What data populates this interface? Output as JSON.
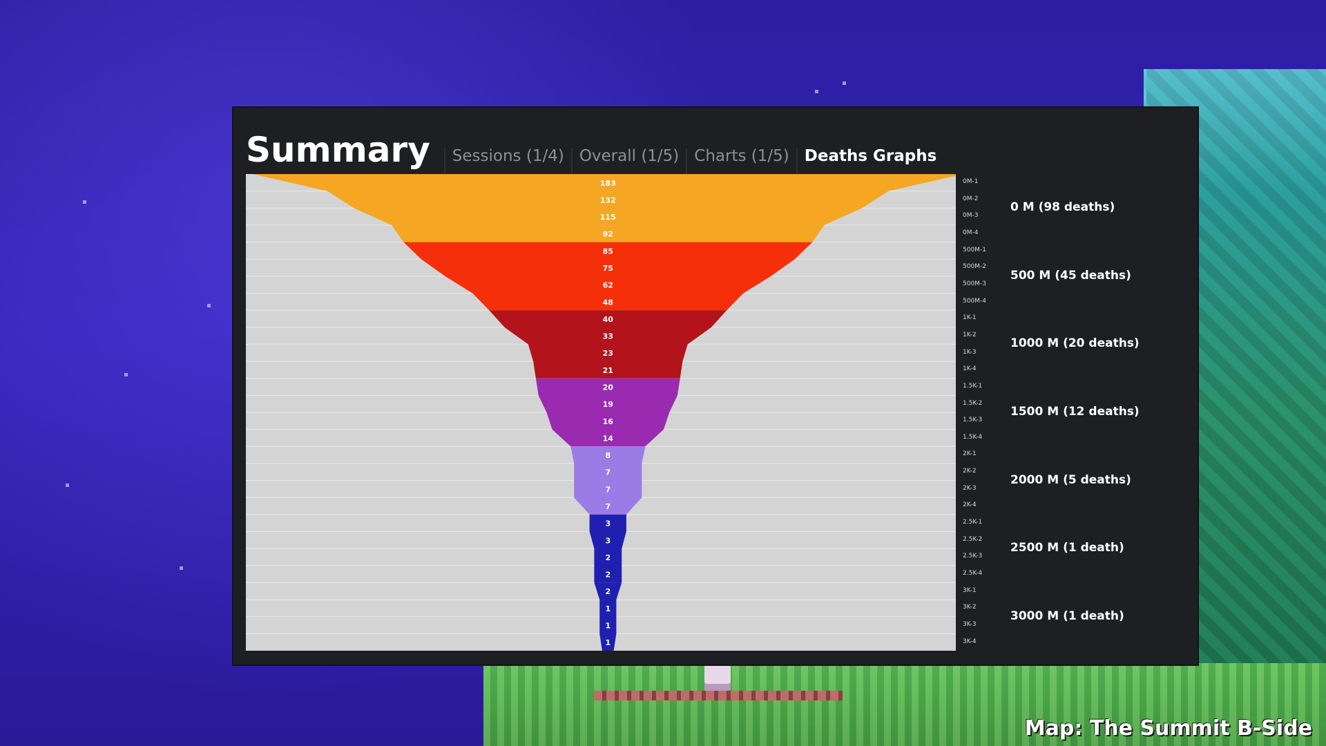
{
  "summary": {
    "title": "Summary",
    "tabs": [
      {
        "label": "Sessions (1/4)",
        "active": false
      },
      {
        "label": "Overall (1/5)",
        "active": false
      },
      {
        "label": "Charts (1/5)",
        "active": false
      },
      {
        "label": "Deaths Graphs",
        "active": true
      }
    ]
  },
  "chart_data": {
    "type": "area",
    "categories": [
      "0M-1",
      "0M-2",
      "0M-3",
      "0M-4",
      "500M-1",
      "500M-2",
      "500M-3",
      "500M-4",
      "1K-1",
      "1K-2",
      "1K-3",
      "1K-4",
      "1.5K-1",
      "1.5K-2",
      "1.5K-3",
      "1.5K-4",
      "2K-1",
      "2K-2",
      "2K-3",
      "2K-4",
      "2.5K-1",
      "2.5K-2",
      "2.5K-3",
      "2.5K-4",
      "3K-1",
      "3K-2",
      "3K-3",
      "3K-4"
    ],
    "values": [
      183,
      132,
      115,
      92,
      85,
      75,
      62,
      48,
      40,
      33,
      23,
      21,
      20,
      19,
      16,
      14,
      8,
      7,
      7,
      7,
      3,
      3,
      2,
      2,
      2,
      1,
      1,
      1
    ],
    "band_colors": [
      "#f5a623",
      "#f52f0a",
      "#b3131a",
      "#9a2bb0",
      "#9b7be6",
      "#1f20b0",
      "#1f20b0"
    ],
    "summaries": [
      {
        "label": "0 M (98 deaths)"
      },
      {
        "label": "500 M (45 deaths)"
      },
      {
        "label": "1000 M (20 deaths)"
      },
      {
        "label": "1500 M (12 deaths)"
      },
      {
        "label": "2000 M (5 deaths)"
      },
      {
        "label": "2500 M (1 death)"
      },
      {
        "label": "3000 M (1 death)"
      }
    ]
  },
  "map": {
    "label": "Map: The Summit B-Side"
  }
}
